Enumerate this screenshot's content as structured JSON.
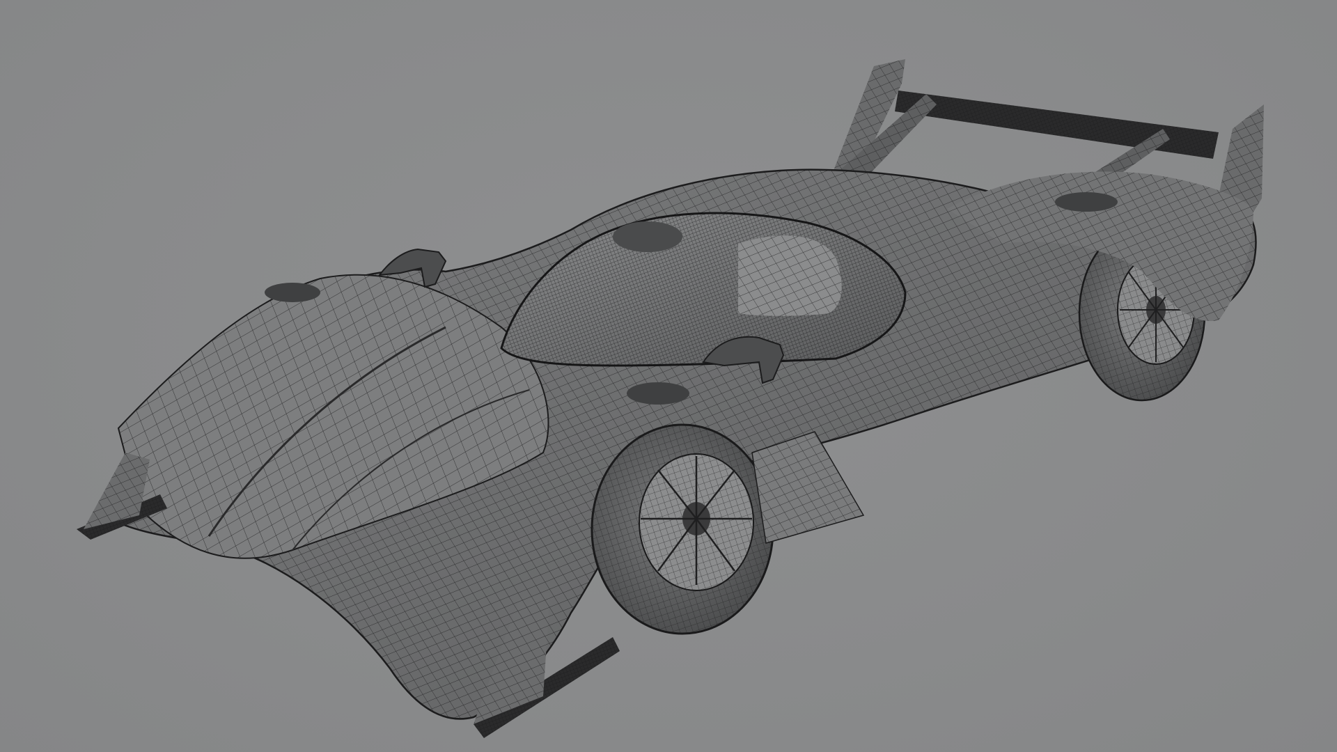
{
  "scene": {
    "subject": "race-car-wireframe-mesh",
    "background_color": "#8a8b8c",
    "mesh_line_color": "#1f1f20",
    "body_shade_color": "#6f7071",
    "dark_part_color": "#2a2a2b"
  }
}
